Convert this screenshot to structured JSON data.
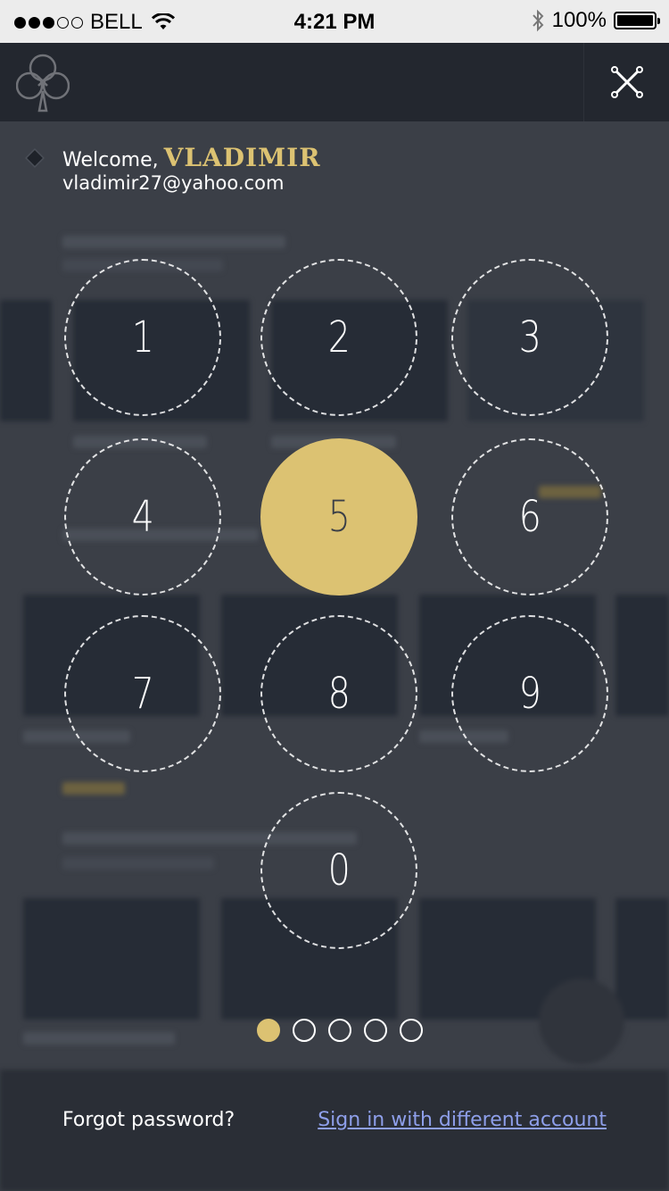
{
  "status_bar": {
    "carrier": "BELL",
    "time": "4:21 PM",
    "battery": "100%",
    "signal_bars_filled": 3,
    "signal_bars_total": 5,
    "battery_level": 1.0
  },
  "header": {
    "logo_icon": "club-logo-icon",
    "close_icon": "close-icon"
  },
  "welcome": {
    "label": "Welcome,",
    "username": "VLADIMIR",
    "email": "vladimir27@yahoo.com"
  },
  "keypad": {
    "keys": [
      "1",
      "2",
      "3",
      "4",
      "5",
      "6",
      "7",
      "8",
      "9",
      "0"
    ],
    "active_key": "5"
  },
  "pin": {
    "length": 5,
    "entered": 1
  },
  "footer": {
    "forgot_label": "Forgot password?",
    "switch_account_label": "Sign in with different account"
  },
  "colors": {
    "accent": "#dcc272",
    "background": "#3b3f47",
    "header": "#23272f",
    "link": "#8e9fea"
  }
}
